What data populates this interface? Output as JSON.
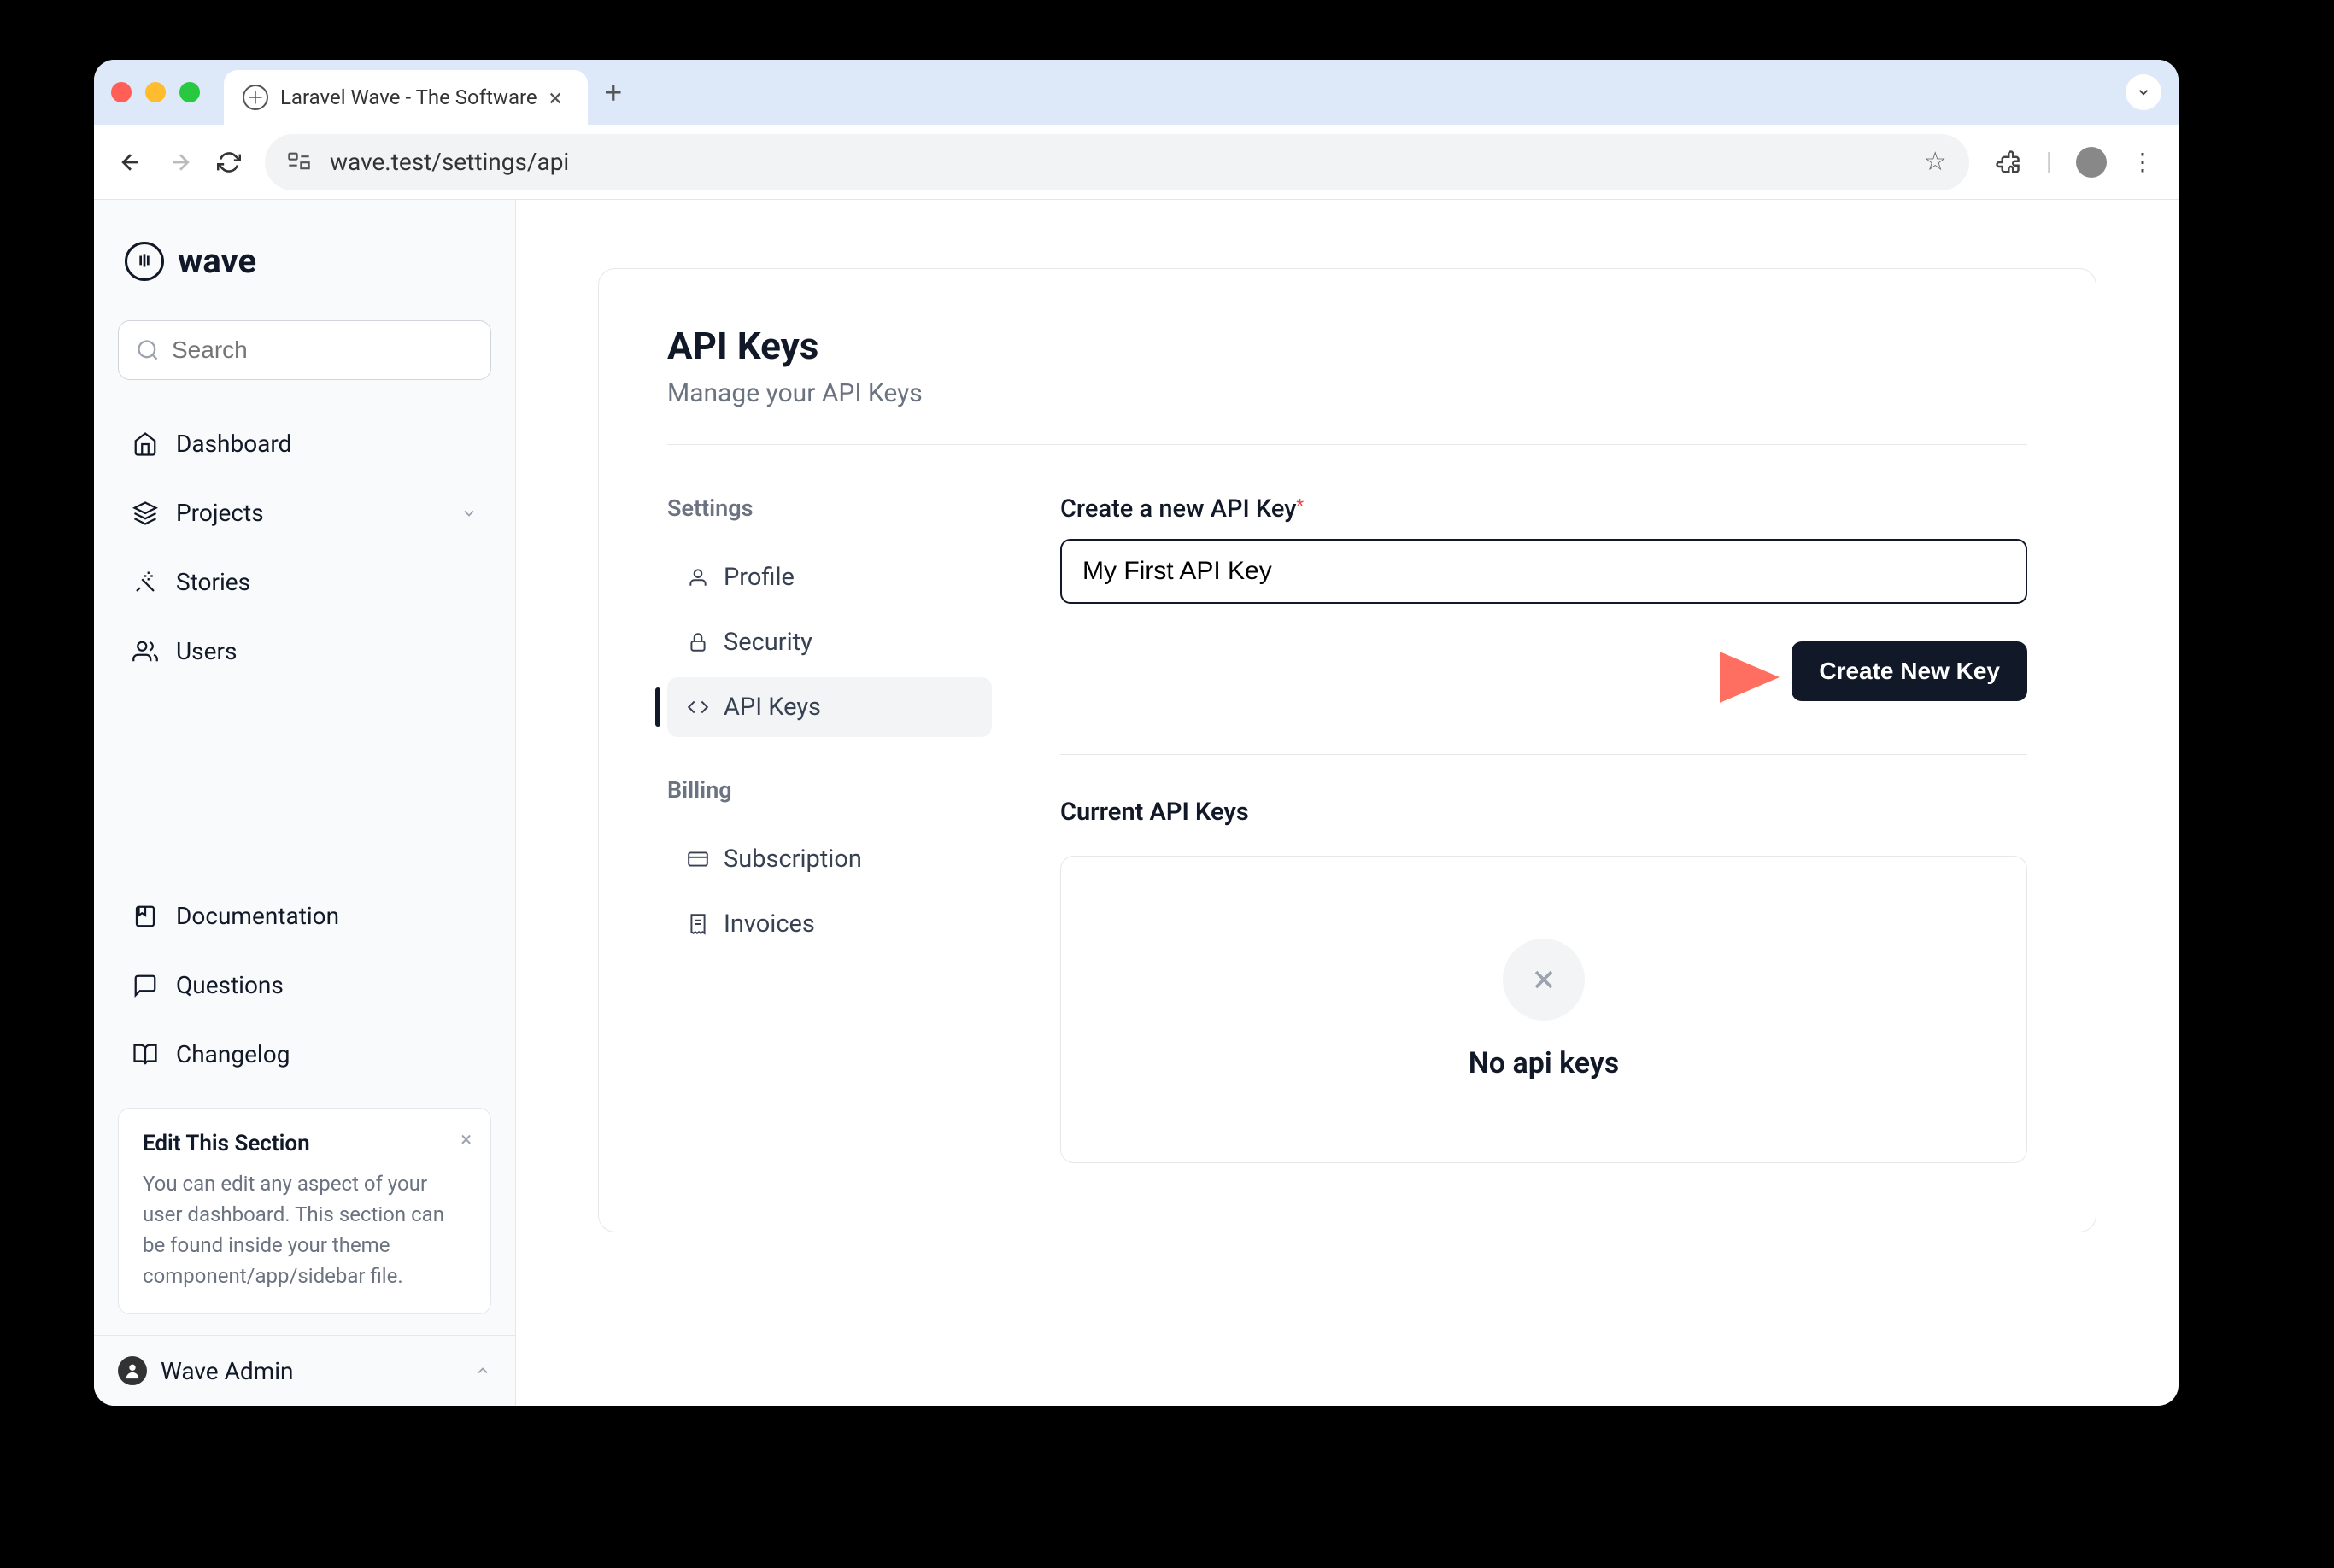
{
  "browser": {
    "tab_title": "Laravel Wave - The Software",
    "url": "wave.test/settings/api"
  },
  "logo": {
    "text": "wave"
  },
  "search": {
    "placeholder": "Search"
  },
  "sidebar": {
    "items": [
      {
        "label": "Dashboard"
      },
      {
        "label": "Projects"
      },
      {
        "label": "Stories"
      },
      {
        "label": "Users"
      }
    ],
    "help": [
      {
        "label": "Documentation"
      },
      {
        "label": "Questions"
      },
      {
        "label": "Changelog"
      }
    ],
    "info_card": {
      "title": "Edit This Section",
      "body": "You can edit any aspect of your user dashboard. This section can be found inside your theme component/app/sidebar file."
    },
    "user_name": "Wave Admin"
  },
  "page": {
    "title": "API Keys",
    "subtitle": "Manage your API Keys"
  },
  "settings_nav": {
    "heading1": "Settings",
    "heading2": "Billing",
    "settings_items": [
      {
        "label": "Profile"
      },
      {
        "label": "Security"
      },
      {
        "label": "API Keys"
      }
    ],
    "billing_items": [
      {
        "label": "Subscription"
      },
      {
        "label": "Invoices"
      }
    ]
  },
  "form": {
    "label": "Create a new API Key",
    "value": "My First API Key",
    "submit": "Create New Key"
  },
  "current": {
    "heading": "Current API Keys",
    "empty_text": "No api keys"
  }
}
